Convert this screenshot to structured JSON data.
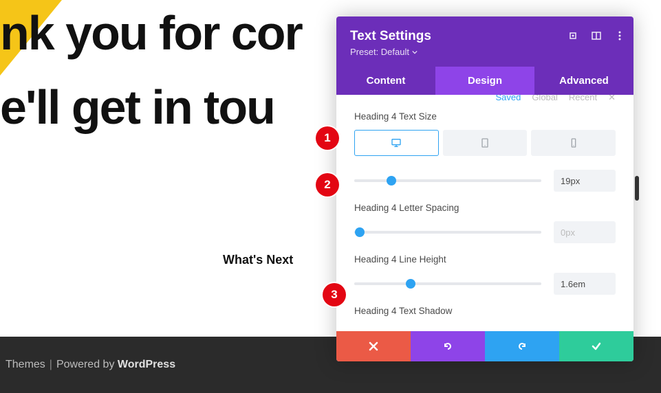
{
  "page": {
    "headline_line1": "nk you for cor",
    "headline_line2": "e'll get in tou",
    "whats_next": "What's Next"
  },
  "footer": {
    "themes": "Themes",
    "sep": "|",
    "powered_by": "Powered by",
    "wordpress": "WordPress"
  },
  "panel": {
    "title": "Text Settings",
    "preset_label": "Preset: Default",
    "tabs": {
      "content": "Content",
      "design": "Design",
      "advanced": "Advanced"
    },
    "filters": {
      "saved": "Saved",
      "global": "Global",
      "recent": "Recent"
    },
    "settings": {
      "text_size": {
        "label": "Heading 4 Text Size",
        "value": "19px",
        "thumb_pct": 20
      },
      "letter_spacing": {
        "label": "Heading 4 Letter Spacing",
        "value": "0px",
        "thumb_pct": 3
      },
      "line_height": {
        "label": "Heading 4 Line Height",
        "value": "1.6em",
        "thumb_pct": 30
      },
      "text_shadow": {
        "label": "Heading 4 Text Shadow"
      }
    }
  },
  "badges": {
    "one": "1",
    "two": "2",
    "three": "3"
  }
}
